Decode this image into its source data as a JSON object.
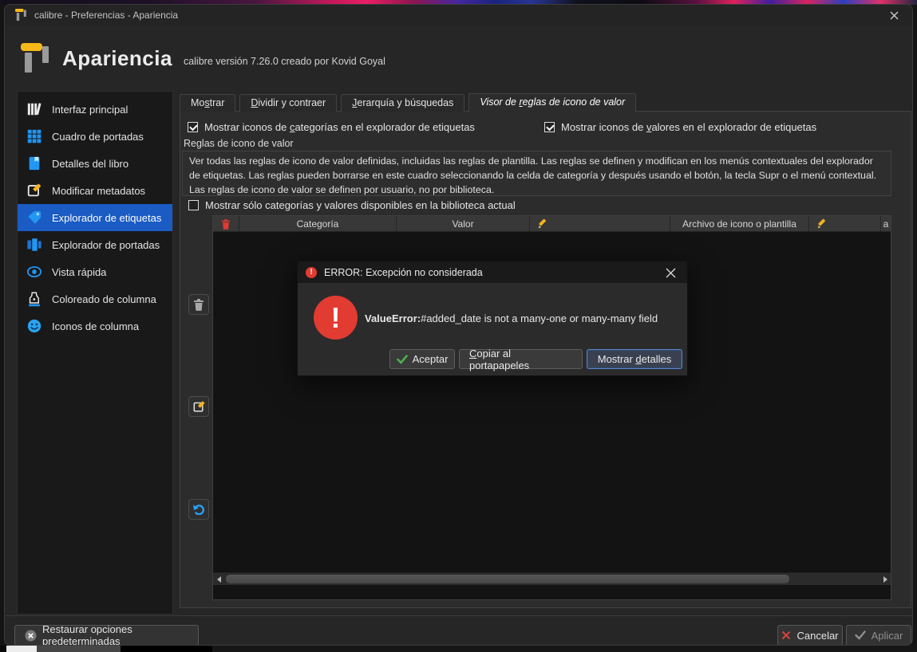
{
  "window": {
    "title": "calibre - Preferencias - Apariencia"
  },
  "header": {
    "title": "Apariencia",
    "subtitle": "calibre versión 7.26.0 creado por Kovid Goyal"
  },
  "sidebar": {
    "items": [
      {
        "label": "Interfaz principal",
        "icon": "library-icon",
        "selected": false
      },
      {
        "label": "Cuadro de portadas",
        "icon": "grid-icon",
        "selected": false
      },
      {
        "label": "Detalles del libro",
        "icon": "book-icon",
        "selected": false
      },
      {
        "label": "Modificar metadatos",
        "icon": "edit-icon",
        "selected": false
      },
      {
        "label": "Explorador de etiquetas",
        "icon": "tag-icon",
        "selected": true
      },
      {
        "label": "Explorador de portadas",
        "icon": "covers-icon",
        "selected": false
      },
      {
        "label": "Vista rápida",
        "icon": "eye-icon",
        "selected": false
      },
      {
        "label": "Coloreado de columna",
        "icon": "ink-icon",
        "selected": false
      },
      {
        "label": "Iconos de columna",
        "icon": "smiley-icon",
        "selected": false
      }
    ]
  },
  "tabs": [
    {
      "pre": "Mo",
      "accel": "s",
      "post": "trar",
      "active": false
    },
    {
      "pre": "",
      "accel": "D",
      "post": "ividir y contraer",
      "active": false
    },
    {
      "pre": "",
      "accel": "J",
      "post": "erarquía y búsquedas",
      "active": false
    },
    {
      "pre": "Visor de ",
      "accel": "r",
      "post": "eglas de icono de valor",
      "active": true
    }
  ],
  "panel": {
    "show_category_icons": {
      "pre": "Mostrar iconos de ",
      "accel": "c",
      "post": "ategorías en el explorador de etiquetas",
      "checked": true
    },
    "show_value_icons": {
      "pre": "Mostrar iconos de ",
      "accel": "v",
      "post": "alores en el explorador de etiquetas",
      "checked": true
    },
    "rules_label": "Reglas de icono de valor",
    "description": "Ver todas las reglas de icono de valor definidas, incluidas las reglas de plantilla. Las reglas se definen y modifican en los menús contextuales del explorador de etiquetas. Las reglas pueden borrarse en este cuadro seleccionando la celda de categoría y después usando el botón, la tecla Supr o el menú contextual. Las reglas de icono de valor se definen por usuario, no por biblioteca.",
    "show_only_current": {
      "label": "Mostrar sólo categorías y valores disponibles en la biblioteca actual",
      "checked": false
    },
    "table": {
      "columns": [
        {
          "icon": "trash-icon",
          "label": ""
        },
        {
          "icon": "",
          "label": "Categoría"
        },
        {
          "icon": "",
          "label": "Valor"
        },
        {
          "icon": "pencil-icon",
          "label": ""
        },
        {
          "icon": "",
          "label": "Archivo de icono o plantilla"
        },
        {
          "icon": "pencil-icon",
          "label": ""
        },
        {
          "icon": "",
          "label": "a"
        }
      ],
      "rows": []
    }
  },
  "dialog": {
    "title": "ERROR: Excepción no considerada",
    "message_bold": "ValueError:",
    "message_rest": "#added_date is not a many-one or many-many field",
    "buttons": {
      "accept": {
        "label": "Aceptar"
      },
      "copy": {
        "pre": "",
        "accel": "C",
        "post": "opiar al portapapeles"
      },
      "details": {
        "pre": "Mostrar ",
        "accel": "d",
        "post": "etalles"
      }
    }
  },
  "footer": {
    "restore": {
      "pre": "Restaurar opciones ",
      "accel": "p",
      "post": "redeterminadas"
    },
    "cancel": {
      "label": "Cancelar"
    },
    "apply": {
      "label": "Aplicar",
      "enabled": false
    }
  },
  "colors": {
    "selection_blue": "#1a5bc4",
    "icon_blue": "#2196f3",
    "error_red": "#e23b32",
    "pencil_yellow": "#f5b21a",
    "check_green": "#4caf50",
    "cancel_red": "#d9413f",
    "calibre_yellow": "#f5b91a"
  },
  "icons": [
    "calibre-logo-icon",
    "close-icon",
    "library-icon",
    "grid-icon",
    "book-icon",
    "edit-icon",
    "tag-icon",
    "covers-icon",
    "eye-icon",
    "ink-icon",
    "smiley-icon",
    "trash-icon",
    "pencil-icon",
    "undo-icon",
    "check-icon",
    "x-icon",
    "error-icon",
    "scroll-left-icon",
    "scroll-right-icon"
  ]
}
